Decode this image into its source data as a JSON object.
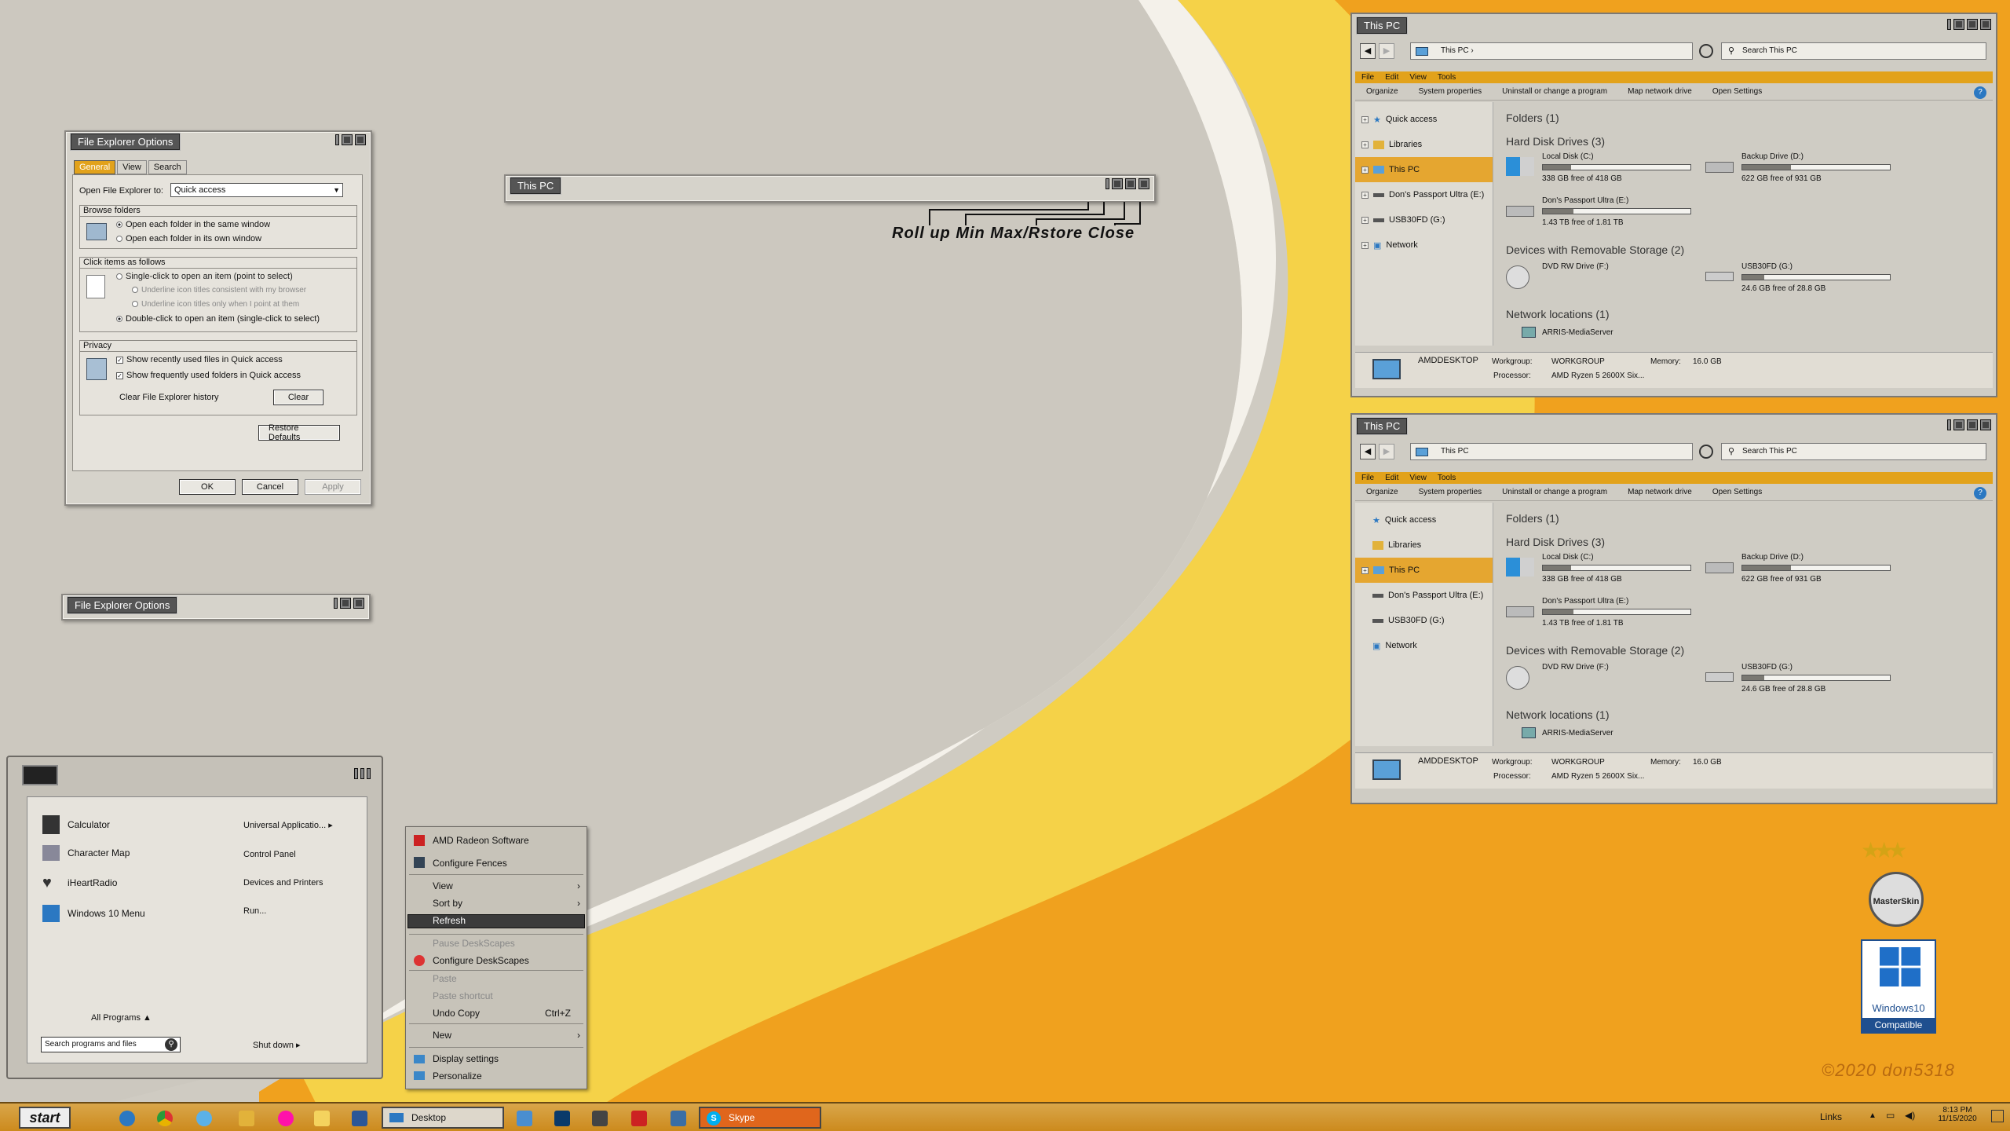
{
  "colors": {
    "accent": "#e2a21b",
    "desk_orange": "#f0a020",
    "wallpaper_gray": "#cbc7bd"
  },
  "annotation": {
    "labels": [
      "Roll up",
      "Min",
      "Max/Rstore",
      "Close"
    ],
    "text": "Roll up Min Max/Rstore Close"
  },
  "thispc_rolled": {
    "title": "This PC"
  },
  "feo_rolled": {
    "title": "File Explorer Options"
  },
  "feo": {
    "title": "File Explorer Options",
    "tabs": [
      "General",
      "View",
      "Search"
    ],
    "open_label": "Open File Explorer to:",
    "open_value": "Quick access",
    "browse": {
      "title": "Browse folders",
      "opt1": "Open each folder in the same window",
      "opt2": "Open each folder in its own window"
    },
    "click": {
      "title": "Click items as follows",
      "opt1": "Single-click to open an item (point to select)",
      "sub1": "Underline icon titles consistent with my browser",
      "sub2": "Underline icon titles only when I point at them",
      "opt2": "Double-click to open an item (single-click to select)"
    },
    "privacy": {
      "title": "Privacy",
      "chk1": "Show recently used files in Quick access",
      "chk2": "Show frequently used folders in Quick access",
      "clear_label": "Clear File Explorer history",
      "clear_btn": "Clear"
    },
    "restore_btn": "Restore Defaults",
    "ok": "OK",
    "cancel": "Cancel",
    "apply": "Apply"
  },
  "explorer": {
    "title": "This PC",
    "address": "This PC",
    "search_placeholder": "Search This PC",
    "menu": [
      "File",
      "Edit",
      "View",
      "Tools"
    ],
    "commands": [
      "Organize",
      "System properties",
      "Uninstall or change a program",
      "Map network drive",
      "Open Settings"
    ],
    "nav": [
      "Quick access",
      "Libraries",
      "This PC",
      "Don's Passport Ultra (E:)",
      "USB30FD (G:)",
      "Network"
    ],
    "sections": {
      "folders": "Folders (1)",
      "hdd": "Hard Disk Drives (3)",
      "removable": "Devices with Removable Storage (2)",
      "network": "Network locations (1)"
    },
    "drives": [
      {
        "name": "Local Disk (C:)",
        "free": "338 GB free of 418 GB",
        "used": 0.19
      },
      {
        "name": "Backup Drive (D:)",
        "free": "622 GB free of 931 GB",
        "used": 0.33
      },
      {
        "name": "Don's Passport Ultra (E:)",
        "free": "1.43 TB free of 1.81 TB",
        "used": 0.21
      },
      {
        "name": "DVD RW Drive (F:)",
        "free": ""
      },
      {
        "name": "USB30FD (G:)",
        "free": "24.6 GB free of 28.8 GB",
        "used": 0.15
      },
      {
        "name": "ARRIS-MediaServer",
        "free": ""
      }
    ],
    "details": {
      "pc": "AMDDESKTOP",
      "workgroup_label": "Workgroup:",
      "workgroup": "WORKGROUP",
      "memory_label": "Memory:",
      "memory": "16.0 GB",
      "processor_label": "Processor:",
      "processor": "AMD Ryzen 5 2600X Six..."
    }
  },
  "startmenu": {
    "pinned": [
      "Calculator",
      "Character Map",
      "iHeartRadio",
      "Windows 10 Menu"
    ],
    "right": [
      "Universal Applicatio...",
      "Control Panel",
      "Devices and Printers",
      "Run..."
    ],
    "all_programs": "All Programs",
    "search_placeholder": "Search programs and files",
    "shutdown": "Shut down"
  },
  "context": {
    "items": [
      "AMD Radeon Software",
      "Configure Fences",
      "View",
      "Sort by",
      "Refresh",
      "Pause DeskScapes",
      "Configure DeskScapes",
      "Paste",
      "Paste shortcut",
      "Undo Copy",
      "New",
      "Display settings",
      "Personalize"
    ],
    "undo_shortcut": "Ctrl+Z"
  },
  "badges": {
    "masterskin": "MasterSkin",
    "win10": "Windows10",
    "compatible": "Compatible",
    "copyright": "©2020 don5318"
  },
  "taskbar": {
    "start": "start",
    "desktop": "Desktop",
    "skype": "Skype",
    "links": "Links",
    "time": "8:13 PM",
    "date": "11/15/2020"
  }
}
